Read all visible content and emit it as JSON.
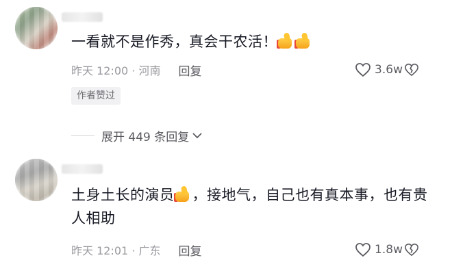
{
  "comments": [
    {
      "text": "一看就不是作秀，真会干农活！",
      "emojis": [
        "thumbs-up-emoji",
        "thumbs-up-emoji"
      ],
      "time": "昨天 12:00 · 河南",
      "reply_label": "回复",
      "likes": "3.6w",
      "author_badge": "作者赞过",
      "expand_label": "展开 449 条回复"
    },
    {
      "text_part1": "土身土长的演员",
      "emoji": "thumbs-up-emoji",
      "text_part2": "，接地气，自己也有真本事，也有贵人相助",
      "time": "昨天 12:01 · 广东",
      "reply_label": "回复",
      "likes": "1.8w"
    }
  ],
  "icons": {
    "like": "heart-outline-icon",
    "dislike": "broken-heart-icon",
    "expand": "chevron-down-icon"
  },
  "colors": {
    "text": "#161823",
    "meta": "#9a9aa0",
    "badge_bg": "#f1f1f3",
    "emoji_yellow": "#ffc533",
    "emoji_red": "#e9473a"
  }
}
